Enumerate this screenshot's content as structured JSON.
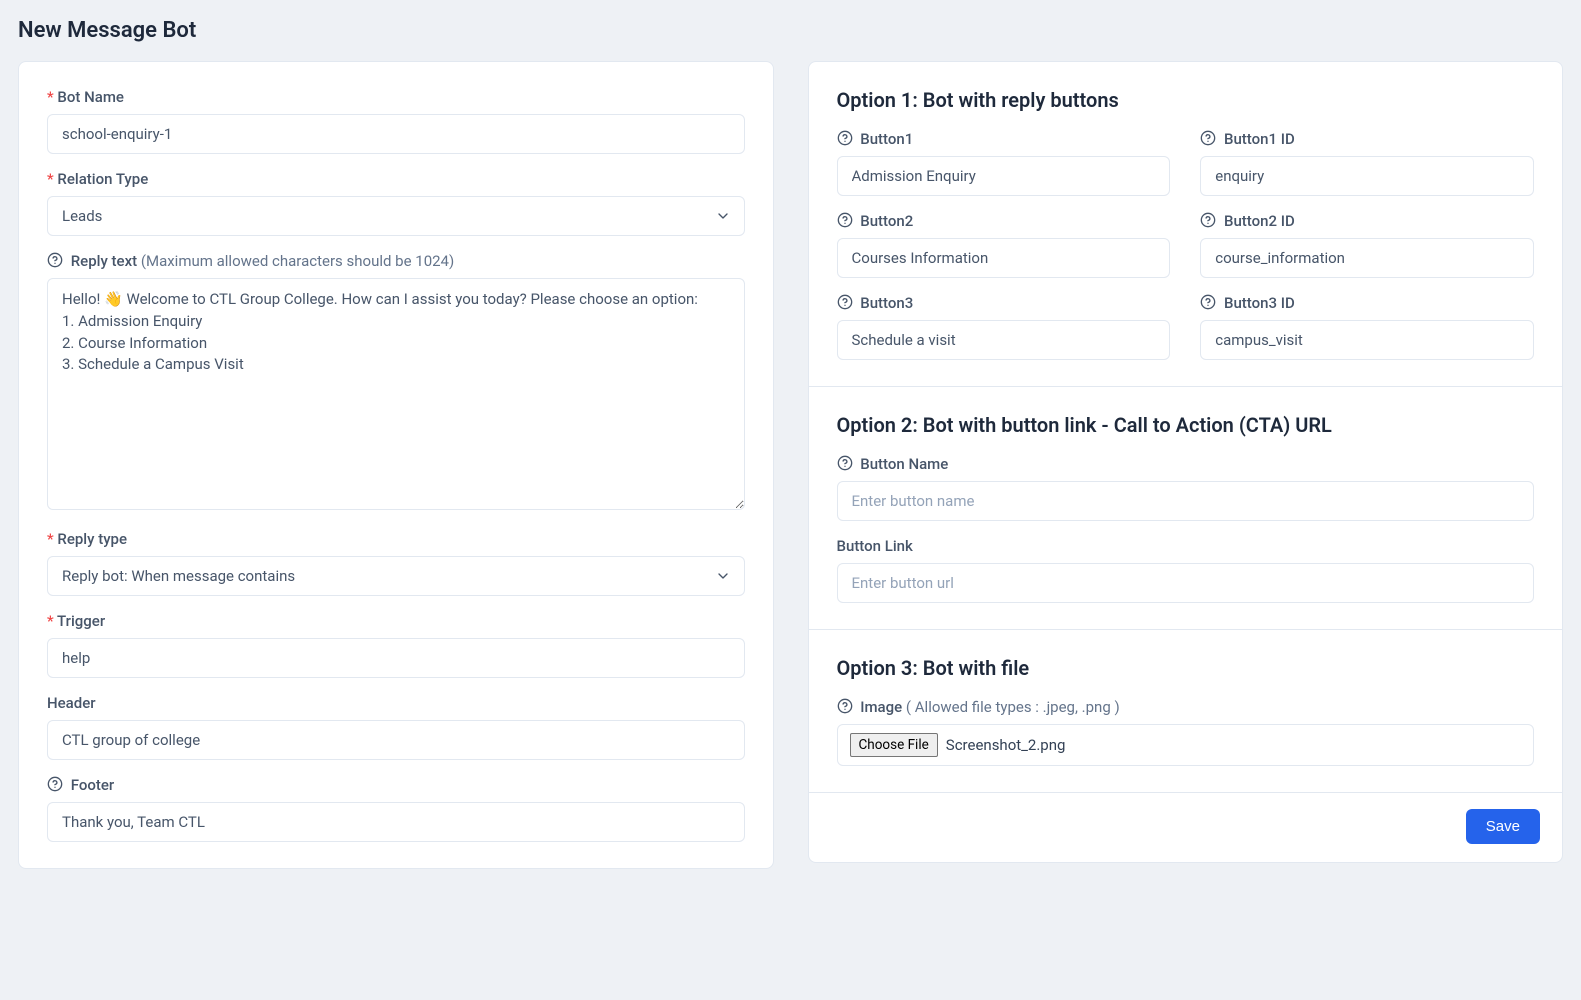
{
  "page": {
    "title": "New Message Bot"
  },
  "left": {
    "bot_name": {
      "label": "Bot Name",
      "value": "school-enquiry-1"
    },
    "relation_type": {
      "label": "Relation Type",
      "value": "Leads"
    },
    "reply_text": {
      "label": "Reply text ",
      "hint": "(Maximum allowed characters should be 1024)",
      "value": "Hello! 👋 Welcome to CTL Group College. How can I assist you today? Please choose an option:\n1. Admission Enquiry\n2. Course Information\n3. Schedule a Campus Visit"
    },
    "reply_type": {
      "label": "Reply type",
      "value": "Reply bot: When message contains"
    },
    "trigger": {
      "label": "Trigger",
      "value": "help"
    },
    "header": {
      "label": "Header",
      "value": "CTL group of college"
    },
    "footer": {
      "label": "Footer",
      "value": "Thank you, Team CTL"
    }
  },
  "option1": {
    "heading": "Option 1: Bot with reply buttons",
    "button1": {
      "label": "Button1",
      "value": "Admission Enquiry"
    },
    "button1_id": {
      "label": "Button1 ID",
      "value": "enquiry"
    },
    "button2": {
      "label": "Button2",
      "value": "Courses Information"
    },
    "button2_id": {
      "label": "Button2 ID",
      "value": "course_information"
    },
    "button3": {
      "label": "Button3",
      "value": "Schedule a visit"
    },
    "button3_id": {
      "label": "Button3 ID",
      "value": "campus_visit"
    }
  },
  "option2": {
    "heading": "Option 2: Bot with button link - Call to Action (CTA) URL",
    "button_name": {
      "label": "Button Name",
      "placeholder": "Enter button name"
    },
    "button_link": {
      "label": "Button Link",
      "placeholder": "Enter button url"
    }
  },
  "option3": {
    "heading": "Option 3: Bot with file",
    "image_label": "Image ",
    "image_hint": "( Allowed file types : .jpeg, .png )",
    "choose_file_label": "Choose File",
    "file_name": "Screenshot_2.png"
  },
  "save_label": "Save"
}
